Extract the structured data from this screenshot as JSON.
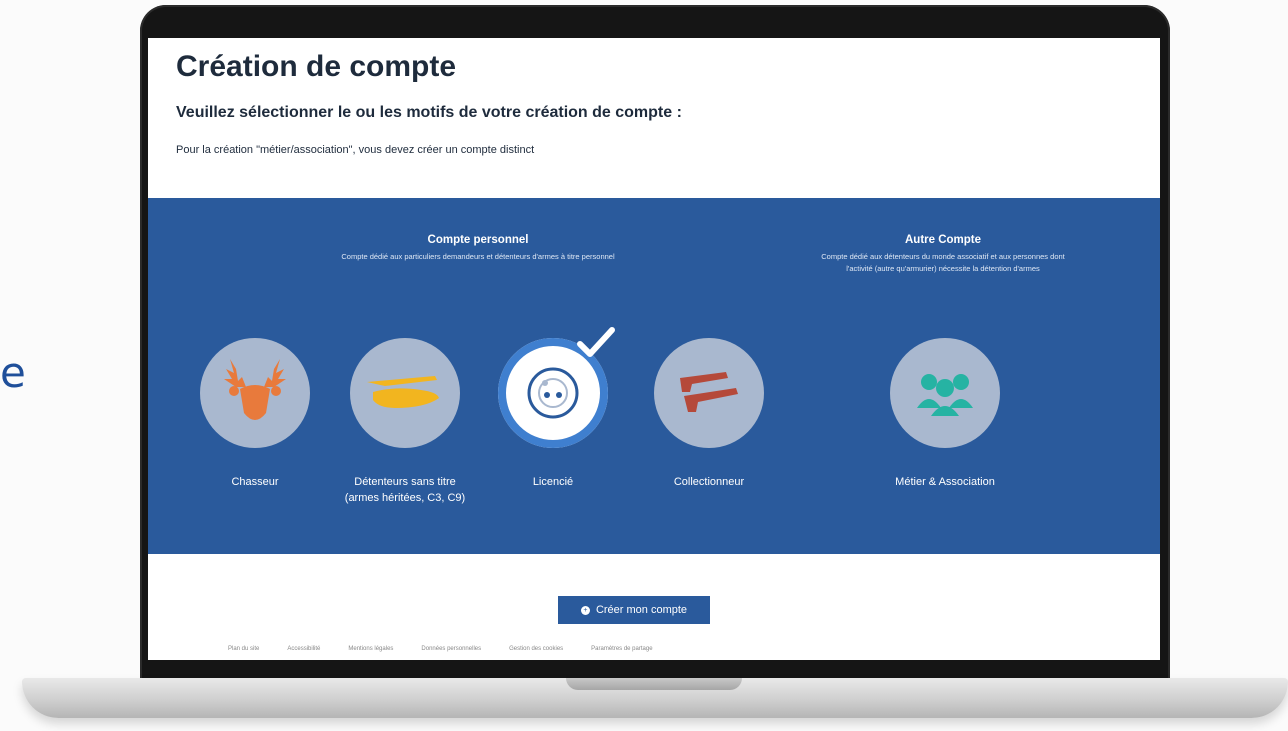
{
  "edge_glyph": "e",
  "page": {
    "title": "Création de compte",
    "subtitle": "Veuillez sélectionner le ou les motifs de votre création de compte :",
    "note": "Pour la création \"métier/association\", vous devez créer un compte distinct"
  },
  "sections": {
    "personal": {
      "title": "Compte personnel",
      "description": "Compte dédié aux particuliers demandeurs et détenteurs d'armes à titre personnel"
    },
    "other": {
      "title": "Autre Compte",
      "description": "Compte dédié aux détenteurs du monde associatif et aux personnes dont l'activité (autre qu'armurier) nécessite la détention d'armes"
    }
  },
  "options": [
    {
      "id": "chasseur",
      "label": "Chasseur",
      "icon": "deer-icon",
      "color": "#e87a3c",
      "selected": false
    },
    {
      "id": "detenteurs",
      "label_line1": "Détenteurs sans titre",
      "label_line2": "(armes héritées, C3, C9)",
      "icon": "hand-weapon-icon",
      "color": "#f2b51f",
      "selected": false
    },
    {
      "id": "licencie",
      "label": "Licencié",
      "icon": "target-icon",
      "color": "#2a5a9c",
      "selected": true
    },
    {
      "id": "collectionneur",
      "label": "Collectionneur",
      "icon": "antique-guns-icon",
      "color": "#b5493a",
      "selected": false
    },
    {
      "id": "metier",
      "label": "Métier & Association",
      "icon": "group-icon",
      "color": "#26b3a3",
      "selected": false
    }
  ],
  "cta": {
    "label": "Créer mon compte",
    "icon": "plus-circle-icon"
  },
  "footer": {
    "links": [
      "Plan du site",
      "Accessibilité",
      "Mentions légales",
      "Données personnelles",
      "Gestion des cookies",
      "Paramètres de partage"
    ]
  },
  "colors": {
    "brand_blue": "#2a5a9c",
    "circle_gray": "#a9b8cf"
  }
}
